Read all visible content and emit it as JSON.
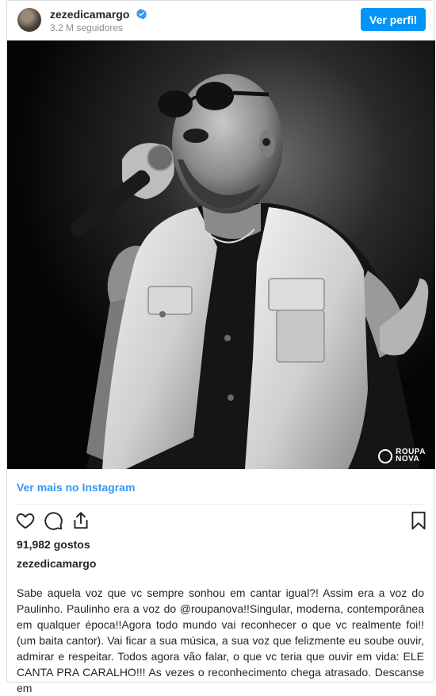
{
  "post": {
    "username": "zezedicamargo",
    "followers": "3.2 M seguidores",
    "follow_button": "Ver perfil",
    "view_more": "Ver mais no Instagram",
    "likes": "91,982 gostos",
    "caption_username": "zezedicamargo",
    "caption_text": "Sabe aquela voz que vc sempre sonhou em cantar igual?! Assim era a voz do Paulinho. Paulinho era a voz do @roupanova!!Singular, moderna, contemporânea em qualquer época!!Agora todo mundo vai reconhecer o que vc realmente foi!! (um baita cantor). Vai ficar a sua música, a sua voz que felizmente eu soube ouvir, admirar e respeitar. Todos agora vão falar, o que vc teria que ouvir em vida: ELE CANTA PRA CARALHO!!! As vezes o reconhecimento chega atrasado. Descanse em"
  },
  "photo": {
    "watermark_line1": "ROUPA",
    "watermark_line2": "NOVA"
  },
  "icons": {
    "avatar": "avatar",
    "verified": "verified-badge-icon",
    "like": "heart-icon",
    "comment": "comment-icon",
    "share": "share-icon",
    "save": "bookmark-icon"
  },
  "colors": {
    "accent": "#0095f6",
    "link": "#3897f0",
    "text": "#262626",
    "muted": "#8e8e8e",
    "border": "#dbdbdb"
  }
}
